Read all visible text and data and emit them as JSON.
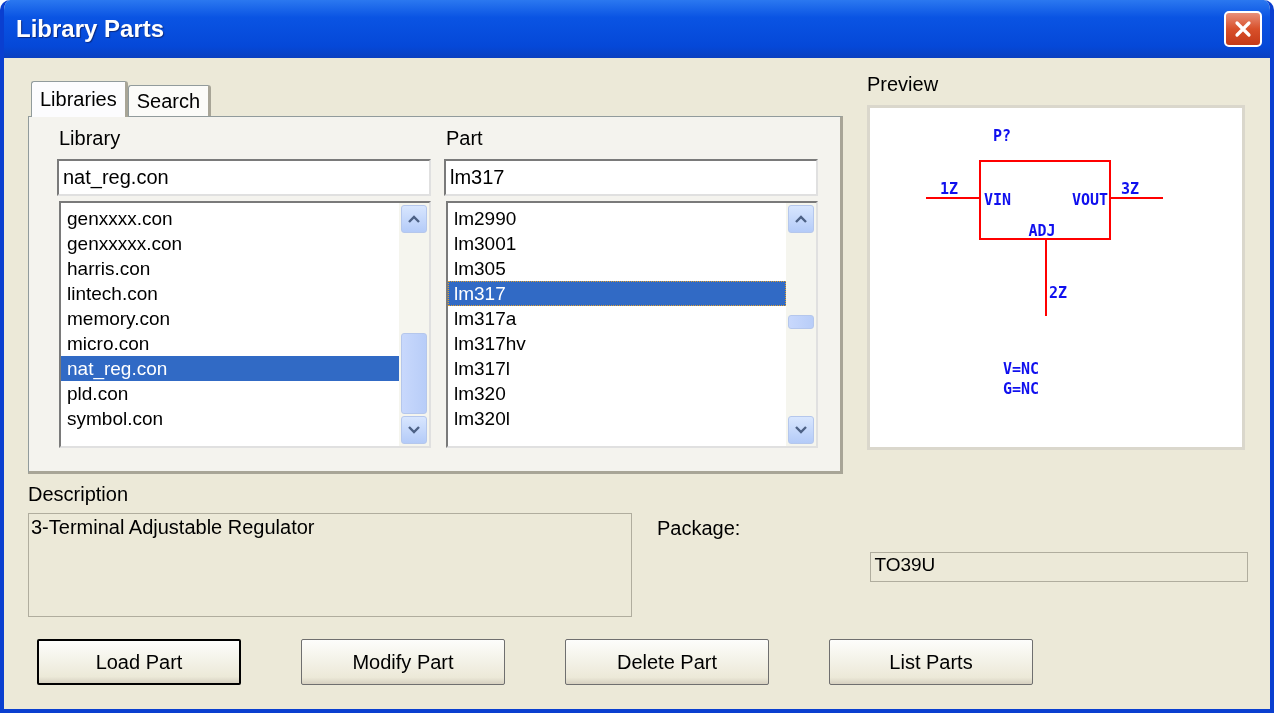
{
  "window": {
    "title": "Library Parts"
  },
  "tabs": [
    {
      "label": "Libraries",
      "selected": true
    },
    {
      "label": "Search",
      "selected": false
    }
  ],
  "library": {
    "label": "Library",
    "value": "nat_reg.con",
    "items": [
      {
        "name": "genxxxx.con",
        "selected": false
      },
      {
        "name": "genxxxxx.con",
        "selected": false
      },
      {
        "name": "harris.con",
        "selected": false
      },
      {
        "name": "lintech.con",
        "selected": false
      },
      {
        "name": "memory.con",
        "selected": false
      },
      {
        "name": "micro.con",
        "selected": false
      },
      {
        "name": "nat_reg.con",
        "selected": true
      },
      {
        "name": "pld.con",
        "selected": false
      },
      {
        "name": "symbol.con",
        "selected": false
      }
    ]
  },
  "part": {
    "label": "Part",
    "value": "lm317",
    "items": [
      {
        "name": "lm2990",
        "selected": false
      },
      {
        "name": "lm3001",
        "selected": false
      },
      {
        "name": "lm305",
        "selected": false
      },
      {
        "name": "lm317",
        "selected": true
      },
      {
        "name": "lm317a",
        "selected": false
      },
      {
        "name": "lm317hv",
        "selected": false
      },
      {
        "name": "lm317l",
        "selected": false
      },
      {
        "name": "lm320",
        "selected": false
      },
      {
        "name": "lm320l",
        "selected": false
      }
    ]
  },
  "preview": {
    "title": "Preview",
    "reference": "P?",
    "pins": [
      {
        "number": "1Z",
        "name": "VIN"
      },
      {
        "number": "3Z",
        "name": "VOUT"
      },
      {
        "number": "2Z",
        "name": "ADJ"
      }
    ],
    "notes": [
      "V=NC",
      "G=NC"
    ]
  },
  "description": {
    "label": "Description",
    "value": "3-Terminal Adjustable Regulator"
  },
  "package": {
    "label": "Package:",
    "value": "TO39U"
  },
  "buttons": [
    {
      "label": "Load Part",
      "default": true
    },
    {
      "label": "Modify Part",
      "default": false
    },
    {
      "label": "Delete Part",
      "default": false
    },
    {
      "label": "List Parts",
      "default": false
    }
  ]
}
